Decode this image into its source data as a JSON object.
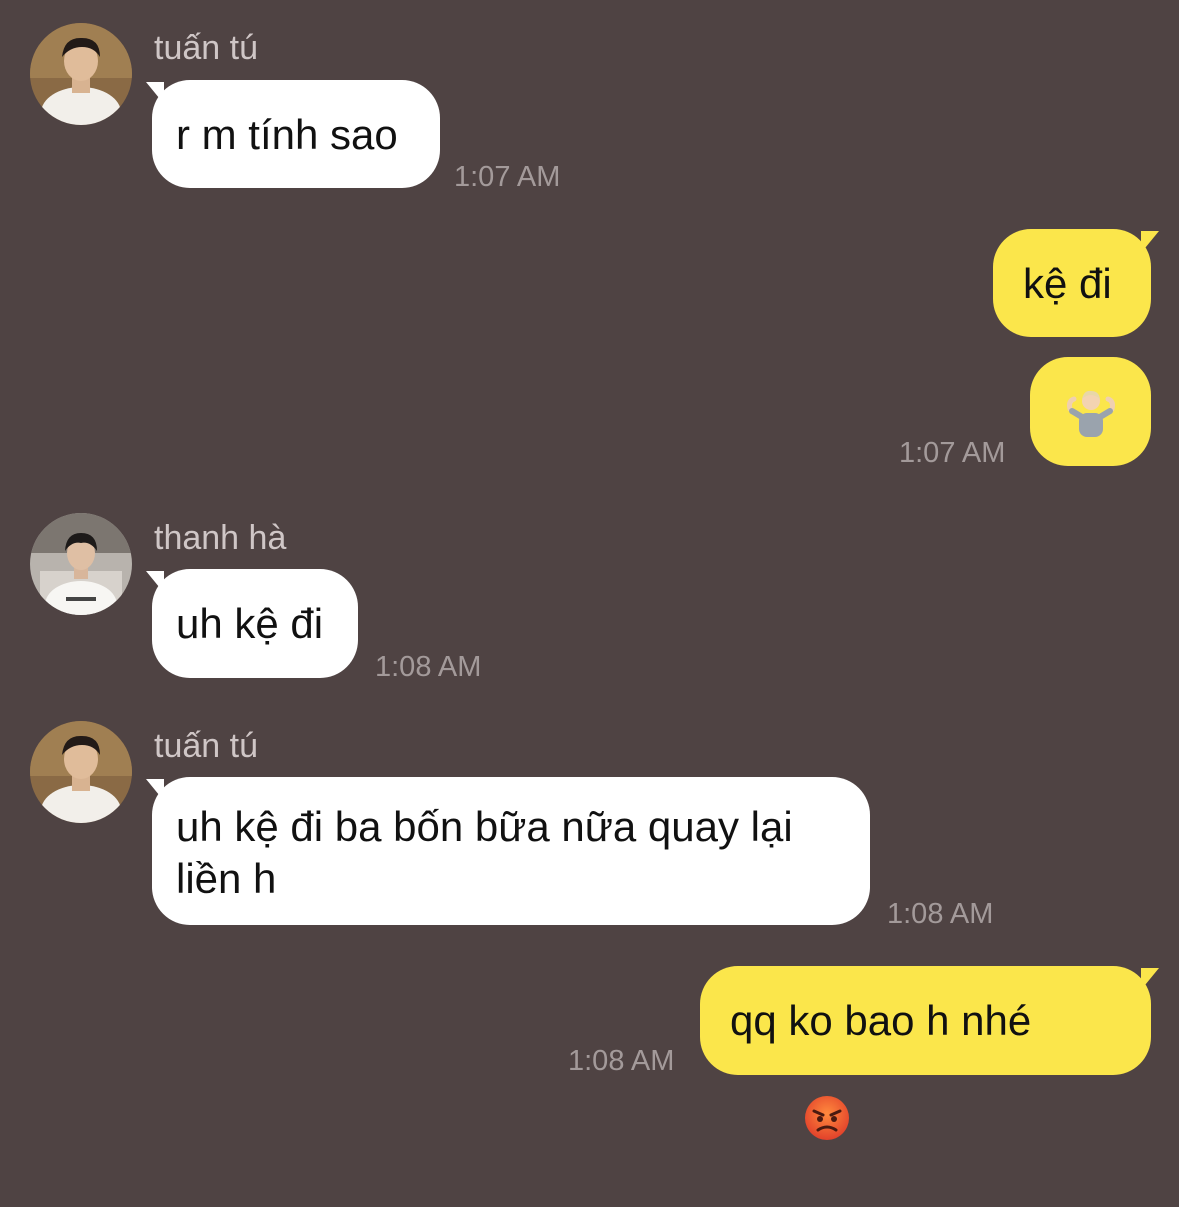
{
  "colors": {
    "background": "#4f4343",
    "incoming_bubble": "#ffffff",
    "outgoing_bubble": "#fbe64b",
    "timestamp": "#a39a9a",
    "sender_name": "#cfc6c6"
  },
  "messages": [
    {
      "direction": "incoming",
      "sender": "tuấn tú",
      "avatar": "avatar-tuan-tu",
      "text": "r m tính sao",
      "time": "1:07 AM"
    },
    {
      "direction": "outgoing",
      "text": "kệ đi",
      "time": ""
    },
    {
      "direction": "outgoing",
      "emoji": "person-shrugging-emoji",
      "text": "🤷🏼‍♂️",
      "time": "1:07 AM"
    },
    {
      "direction": "incoming",
      "sender": "thanh hà",
      "avatar": "avatar-thanh-ha",
      "text": "uh kệ đi",
      "time": "1:08 AM"
    },
    {
      "direction": "incoming",
      "sender": "tuấn tú",
      "avatar": "avatar-tuan-tu",
      "text": "uh kệ đi ba bốn bữa nữa quay lại\nliền h",
      "time": "1:08 AM"
    },
    {
      "direction": "outgoing",
      "text": "qq ko bao h nhé",
      "emoji": "angry-face-emoji",
      "time": "1:08 AM"
    }
  ]
}
